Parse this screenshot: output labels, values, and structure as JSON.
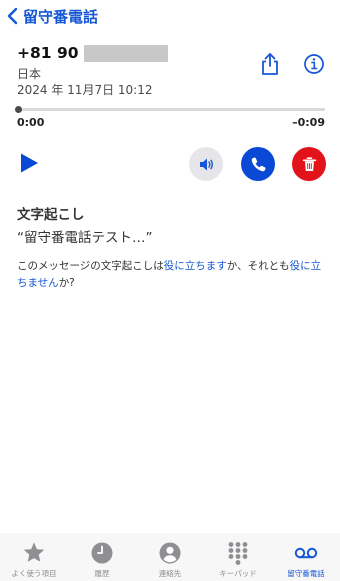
{
  "nav": {
    "back_label": "留守番電話"
  },
  "message": {
    "number": "+81 90",
    "country": "日本",
    "date": "2024 年 11月7日 10:12"
  },
  "player": {
    "current": "0:00",
    "remaining": "–0:09"
  },
  "transcript": {
    "title": "文字起こし",
    "text": "“留守番電話テスト…”",
    "feedback_prefix": "このメッセージの文字起こしは",
    "feedback_yes": "役に立ちます",
    "feedback_mid": "か、それとも",
    "feedback_no": "役に立ちません",
    "feedback_suffix": "か?"
  },
  "tabs": [
    {
      "label": "よく使う項目",
      "icon": "star-icon"
    },
    {
      "label": "履歴",
      "icon": "clock-icon"
    },
    {
      "label": "連絡先",
      "icon": "person-circle-icon"
    },
    {
      "label": "キーパッド",
      "icon": "keypad-icon"
    },
    {
      "label": "留守番電話",
      "icon": "voicemail-icon",
      "active": true
    }
  ],
  "colors": {
    "accent": "#1557d6",
    "call": "#0a49d6",
    "delete": "#e3131b",
    "inactive": "#8e8e93"
  }
}
